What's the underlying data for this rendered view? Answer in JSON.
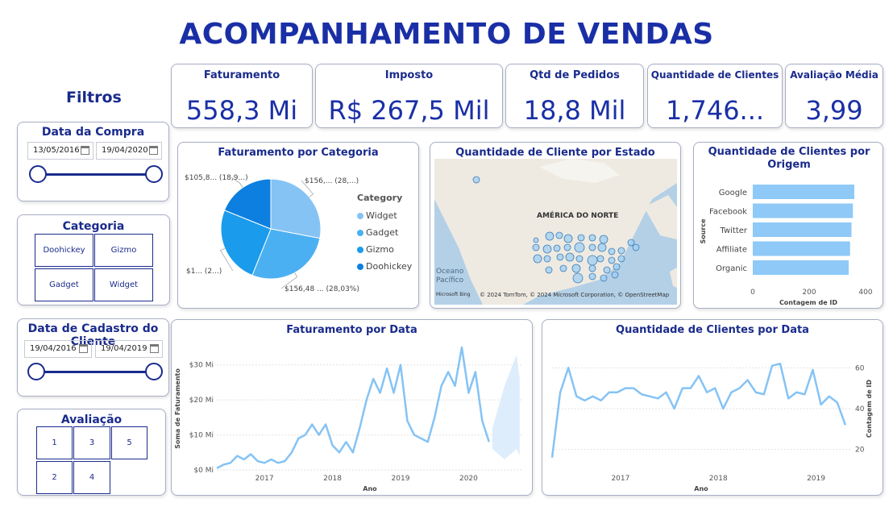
{
  "title": "ACOMPANHAMENTO DE VENDAS",
  "filters_heading": "Filtros",
  "kpis": [
    {
      "label": "Faturamento",
      "value": "558,3 Mi"
    },
    {
      "label": "Imposto",
      "value": "R$ 267,5 Mil"
    },
    {
      "label": "Qtd de Pedidos",
      "value": "18,8 Mil"
    },
    {
      "label": "Quantidade de Clientes",
      "value": "1,746..."
    },
    {
      "label": "Avaliação Média",
      "value": "3,99"
    }
  ],
  "slicer_compra": {
    "title": "Data da Compra",
    "start": "13/05/2016",
    "end": "19/04/2020"
  },
  "slicer_categoria": {
    "title": "Categoria",
    "items": [
      "Doohickey",
      "Gizmo",
      "Gadget",
      "Widget"
    ]
  },
  "slicer_cadastro": {
    "title": "Data de Cadastro do Cliente",
    "start": "19/04/2016",
    "end": "19/04/2019"
  },
  "slicer_avaliacao": {
    "title": "Avaliação",
    "items": [
      "1",
      "3",
      "5",
      "2",
      "4"
    ]
  },
  "colors": {
    "accent": "#1a2fa6",
    "light_blue": "#85c3f5",
    "bar_blue": "#8ec9f7"
  },
  "map": {
    "title": "Quantidade de Cliente por Estado",
    "region_label": "AMÉRICA DO NORTE",
    "ocean_label": "Oceano Pacífico",
    "attribution": "© 2024 TomTom, © 2024 Microsoft Corporation, © OpenStreetMap",
    "bing": "Microsoft Bing"
  },
  "chart_data": [
    {
      "type": "pie",
      "title": "Faturamento por Categoria",
      "legend_title": "Category",
      "legend_position": "right",
      "categories": [
        "Widget",
        "Gadget",
        "Gizmo",
        "Doohickey"
      ],
      "values": [
        28,
        28.03,
        25,
        18.9
      ],
      "colors": [
        "#85c3f5",
        "#4ab0f2",
        "#1a9bec",
        "#0c7fe0"
      ],
      "data_labels": [
        "$156,... (28,...)",
        "$156,48 ... (28,03%)",
        "$1... (2...)",
        "$105,8... (18,9...)"
      ]
    },
    {
      "type": "bar",
      "orientation": "horizontal",
      "title": "Quantidade de Clientes por Origem",
      "categories": [
        "Google",
        "Facebook",
        "Twitter",
        "Affiliate",
        "Organic"
      ],
      "values": [
        360,
        355,
        350,
        345,
        340
      ],
      "xlabel": "Contagem de ID",
      "ylabel": "Source",
      "xlim": [
        0,
        400
      ],
      "xticks": [
        "0",
        "200",
        "400"
      ]
    },
    {
      "type": "line",
      "title": "Faturamento por Data",
      "xlabel": "Ano",
      "ylabel": "Soma de Faturamento",
      "yticks": [
        "$0 Mi",
        "$10 Mi",
        "$20 Mi",
        "$30 Mi"
      ],
      "xticks": [
        "2017",
        "2018",
        "2019",
        "2020"
      ],
      "ylim": [
        0,
        35
      ],
      "x": [
        2016.3,
        2016.4,
        2016.5,
        2016.6,
        2016.7,
        2016.8,
        2016.9,
        2017.0,
        2017.1,
        2017.2,
        2017.3,
        2017.4,
        2017.5,
        2017.6,
        2017.7,
        2017.8,
        2017.9,
        2018.0,
        2018.1,
        2018.2,
        2018.3,
        2018.4,
        2018.5,
        2018.6,
        2018.7,
        2018.8,
        2018.9,
        2019.0,
        2019.1,
        2019.2,
        2019.3,
        2019.4,
        2019.5,
        2019.6,
        2019.7,
        2019.8,
        2019.9,
        2020.0,
        2020.1,
        2020.2,
        2020.3
      ],
      "y": [
        0.5,
        1.5,
        2,
        4,
        3,
        4.5,
        2.5,
        2,
        3,
        2,
        2.5,
        5,
        9,
        10,
        13,
        10,
        13,
        7,
        5,
        8,
        5,
        12,
        20,
        26,
        22,
        29,
        22,
        30,
        14,
        10,
        9,
        8,
        15,
        24,
        28,
        24,
        35,
        22,
        28,
        14,
        8
      ],
      "forecast": true
    },
    {
      "type": "line",
      "title": "Quantidade de Clientes por Data",
      "xlabel": "Ano",
      "ylabel": "Contagem de ID",
      "yticks": [
        "20",
        "40",
        "60"
      ],
      "xticks": [
        "2017",
        "2018",
        "2019"
      ],
      "ylim": [
        10,
        70
      ],
      "x": [
        2016.3,
        2016.4,
        2016.5,
        2016.6,
        2016.7,
        2016.8,
        2016.9,
        2017.0,
        2017.1,
        2017.2,
        2017.3,
        2017.4,
        2017.5,
        2017.6,
        2017.7,
        2017.8,
        2017.9,
        2018.0,
        2018.1,
        2018.2,
        2018.3,
        2018.4,
        2018.5,
        2018.6,
        2018.7,
        2018.8,
        2018.9,
        2019.0,
        2019.1,
        2019.2,
        2019.3
      ],
      "y": [
        16,
        48,
        60,
        46,
        44,
        46,
        44,
        48,
        48,
        50,
        50,
        47,
        46,
        45,
        48,
        40,
        50,
        50,
        56,
        48,
        50,
        40,
        48,
        50,
        54,
        48,
        47,
        61,
        62,
        45,
        48,
        47,
        59,
        42,
        46,
        43,
        32
      ]
    }
  ]
}
